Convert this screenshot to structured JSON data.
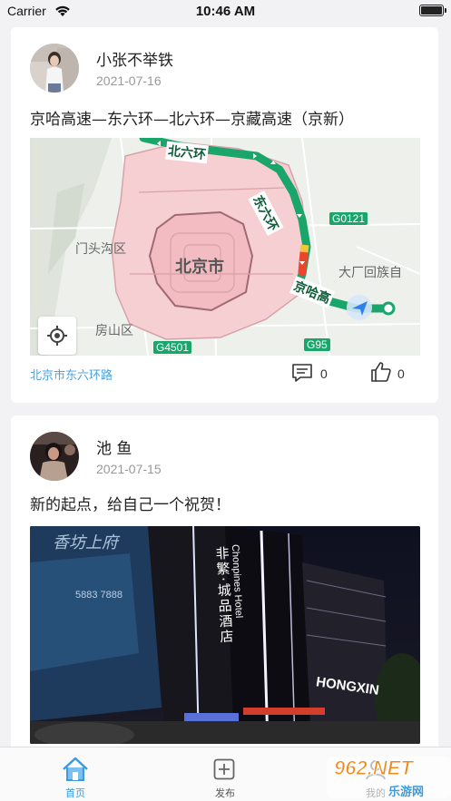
{
  "status_bar": {
    "carrier": "Carrier",
    "time": "10:46 AM"
  },
  "posts": [
    {
      "username": "小张不举铁",
      "date": "2021-07-16",
      "text": "京哈高速—东六环—北六环—京藏高速（京新）",
      "map": {
        "labels": {
          "beijing": "北京市",
          "mentougou": "门头沟区",
          "fangshan": "房山区",
          "dachang": "大厂回族自",
          "north_ring": "北六环",
          "east_ring": "东六环",
          "jingha": "京哈高"
        },
        "road_badges": [
          "G0121",
          "G4501",
          "G95"
        ]
      },
      "location": "北京市东六环路",
      "comment_count": "0",
      "like_count": "0"
    },
    {
      "username": "池 鱼",
      "date": "2021-07-15",
      "text": "新的起点，给自己一个祝贺！",
      "photo_texts": {
        "hotel_cn": "非繁·城品酒店",
        "hotel_en": "Chonpines Hotel",
        "building_sign": "HONGXIN",
        "billboard": "香坊上府",
        "phone": "5883 7888"
      }
    }
  ],
  "tabbar": {
    "items": [
      {
        "label": "首页",
        "icon": "home-icon",
        "active": true
      },
      {
        "label": "发布",
        "icon": "add-square-icon",
        "active": false
      },
      {
        "label": "我的",
        "icon": "person-icon",
        "active": false
      }
    ]
  },
  "watermark": {
    "text": "962.NET",
    "subtext": "乐游网"
  },
  "colors": {
    "accent": "#3b9be0",
    "link": "#4aa3df",
    "route": "#1aa66b",
    "beijing_area": "#f6cfd2"
  }
}
